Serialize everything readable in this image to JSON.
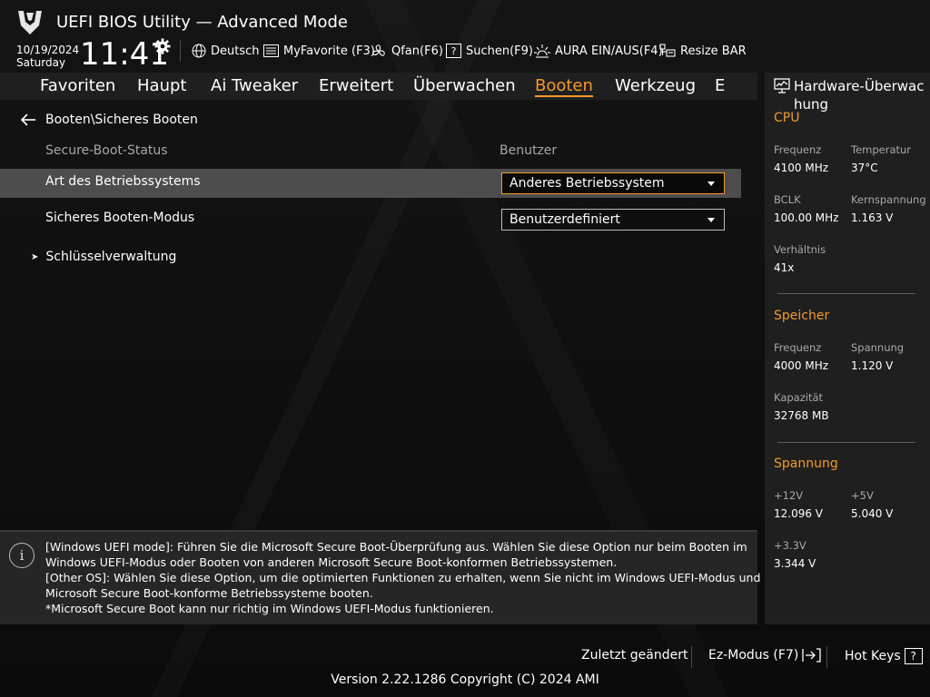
{
  "header": {
    "title": "UEFI BIOS Utility — Advanced Mode",
    "date": "10/19/2024",
    "weekday": "Saturday",
    "time": "11:41",
    "items": [
      {
        "name": "language",
        "icon": "globe-icon",
        "label": "Deutsch"
      },
      {
        "name": "myfavorite",
        "icon": "favorite-list-icon",
        "label": "MyFavorite (F3)"
      },
      {
        "name": "qfan",
        "icon": "fan-icon",
        "label": "Qfan(F6)"
      },
      {
        "name": "search",
        "icon": "search-help-icon",
        "label": "Suchen(F9)"
      },
      {
        "name": "aura",
        "icon": "aura-light-icon",
        "label": "AURA EIN/AUS(F4)"
      },
      {
        "name": "resize-bar",
        "icon": "resize-bar-icon",
        "label": "Resize BAR"
      }
    ]
  },
  "menu": {
    "tabs": [
      "Favoriten",
      "Haupt",
      "Ai Tweaker",
      "Erweitert",
      "Überwachen",
      "Booten",
      "Werkzeug",
      "E"
    ],
    "active": "Booten"
  },
  "main": {
    "breadcrumb": "Booten\\Sicheres Booten",
    "status": {
      "label": "Secure-Boot-Status",
      "value": "Benutzer"
    },
    "os_type": {
      "label": "Art des Betriebssystems",
      "value": "Anderes Betriebssystem"
    },
    "boot_mode": {
      "label": "Sicheres Booten-Modus",
      "value": "Benutzerdefiniert"
    },
    "key_management": {
      "label": "Schlüsselverwaltung"
    }
  },
  "info": {
    "lines": [
      "[Windows UEFI mode]: Führen Sie die Microsoft Secure Boot-Überprüfung aus. Wählen Sie diese Option nur beim Booten im",
      "Windows UEFI-Modus oder Booten von anderen Microsoft Secure Boot-konformen Betriebssystemen.",
      "[Other OS]: Wählen Sie diese Option, um die optimierten Funktionen zu erhalten, wenn Sie nicht im Windows UEFI-Modus und nicht",
      "Microsoft Secure Boot-konforme Betriebssysteme booten.",
      "*Microsoft Secure Boot kann nur richtig im Windows UEFI-Modus funktionieren."
    ]
  },
  "hw": {
    "title_line1": "Hardware-Überwac",
    "title_line2": "hung",
    "cpu": {
      "heading": "CPU",
      "freq_label": "Frequenz",
      "freq": "4100 MHz",
      "temp_label": "Temperatur",
      "temp": "37°C",
      "bclk_label": "BCLK",
      "bclk": "100.00 MHz",
      "vcore_label": "Kernspannung",
      "vcore": "1.163 V",
      "ratio_label": "Verhältnis",
      "ratio": "41x"
    },
    "memory": {
      "heading": "Speicher",
      "freq_label": "Frequenz",
      "freq": "4000 MHz",
      "volt_label": "Spannung",
      "volt": "1.120 V",
      "cap_label": "Kapazität",
      "cap": "32768 MB"
    },
    "voltage": {
      "heading": "Spannung",
      "v12_label": "+12V",
      "v12": "12.096 V",
      "v5_label": "+5V",
      "v5": "5.040 V",
      "v33_label": "+3.3V",
      "v33": "3.344 V"
    }
  },
  "footer": {
    "last_changed": "Zuletzt geändert",
    "ez_mode": "Ez-Modus (F7)",
    "hot_keys": "Hot Keys",
    "hot_keys_key": "?",
    "version": "Version 2.22.1286 Copyright (C) 2024 AMI"
  },
  "colors": {
    "accent": "#f39a2b",
    "panel": "#1f1f1f",
    "highlight": "#4d4d4d"
  }
}
